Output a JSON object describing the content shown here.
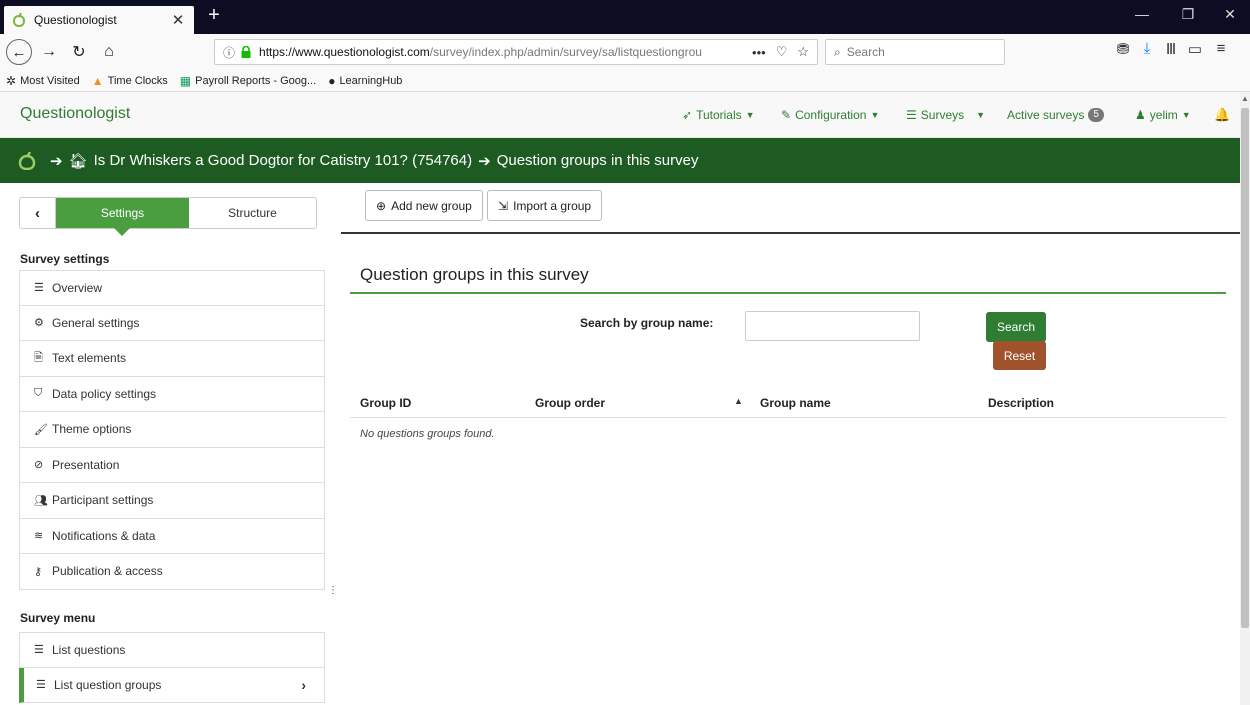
{
  "browser": {
    "tab_title": "Questionologist",
    "url_domain": "https://www.questionologist.com",
    "url_path": "/survey/index.php/admin/survey/sa/listquestiongrou",
    "search_placeholder": "Search",
    "bookmarks": [
      "Most Visited",
      "Time Clocks",
      "Payroll Reports - Goog...",
      "LearningHub"
    ]
  },
  "app": {
    "brand": "Questionologist",
    "nav": {
      "tutorials": "Tutorials",
      "configuration": "Configuration",
      "surveys": "Surveys",
      "active_surveys": "Active surveys",
      "active_count": "5",
      "user": "yelim"
    },
    "breadcrumb": {
      "survey": "Is Dr Whiskers a Good Dogtor for Catistry 101? (754764)",
      "page": "Question groups in this survey"
    }
  },
  "sidebar": {
    "toggle": {
      "settings": "Settings",
      "structure": "Structure"
    },
    "survey_settings_title": "Survey settings",
    "settings_items": [
      {
        "label": "Overview",
        "icon": "list-icon"
      },
      {
        "label": "General settings",
        "icon": "gears-icon"
      },
      {
        "label": "Text elements",
        "icon": "file-text-icon"
      },
      {
        "label": "Data policy settings",
        "icon": "shield-icon"
      },
      {
        "label": "Theme options",
        "icon": "brush-icon"
      },
      {
        "label": "Presentation",
        "icon": "eye-slash-icon"
      },
      {
        "label": "Participant settings",
        "icon": "users-icon"
      },
      {
        "label": "Notifications & data",
        "icon": "rss-icon"
      },
      {
        "label": "Publication & access",
        "icon": "key-icon"
      }
    ],
    "survey_menu_title": "Survey menu",
    "menu_items": [
      {
        "label": "List questions",
        "icon": "list-icon"
      },
      {
        "label": "List question groups",
        "icon": "list-icon",
        "active": true
      }
    ]
  },
  "main": {
    "toolbar": {
      "add_group": "Add new group",
      "import_group": "Import a group"
    },
    "title": "Question groups in this survey",
    "search_label": "Search by group name:",
    "search_value": "",
    "search_button": "Search",
    "reset_button": "Reset",
    "columns": [
      "Group ID",
      "Group order",
      "Group name",
      "Description"
    ],
    "empty_message": "No questions groups found."
  },
  "colors": {
    "brand_green": "#2e7d32",
    "title_bar": "#1d5b22",
    "accent_green": "#4a9e3f",
    "reset_brown": "#a0522d"
  }
}
